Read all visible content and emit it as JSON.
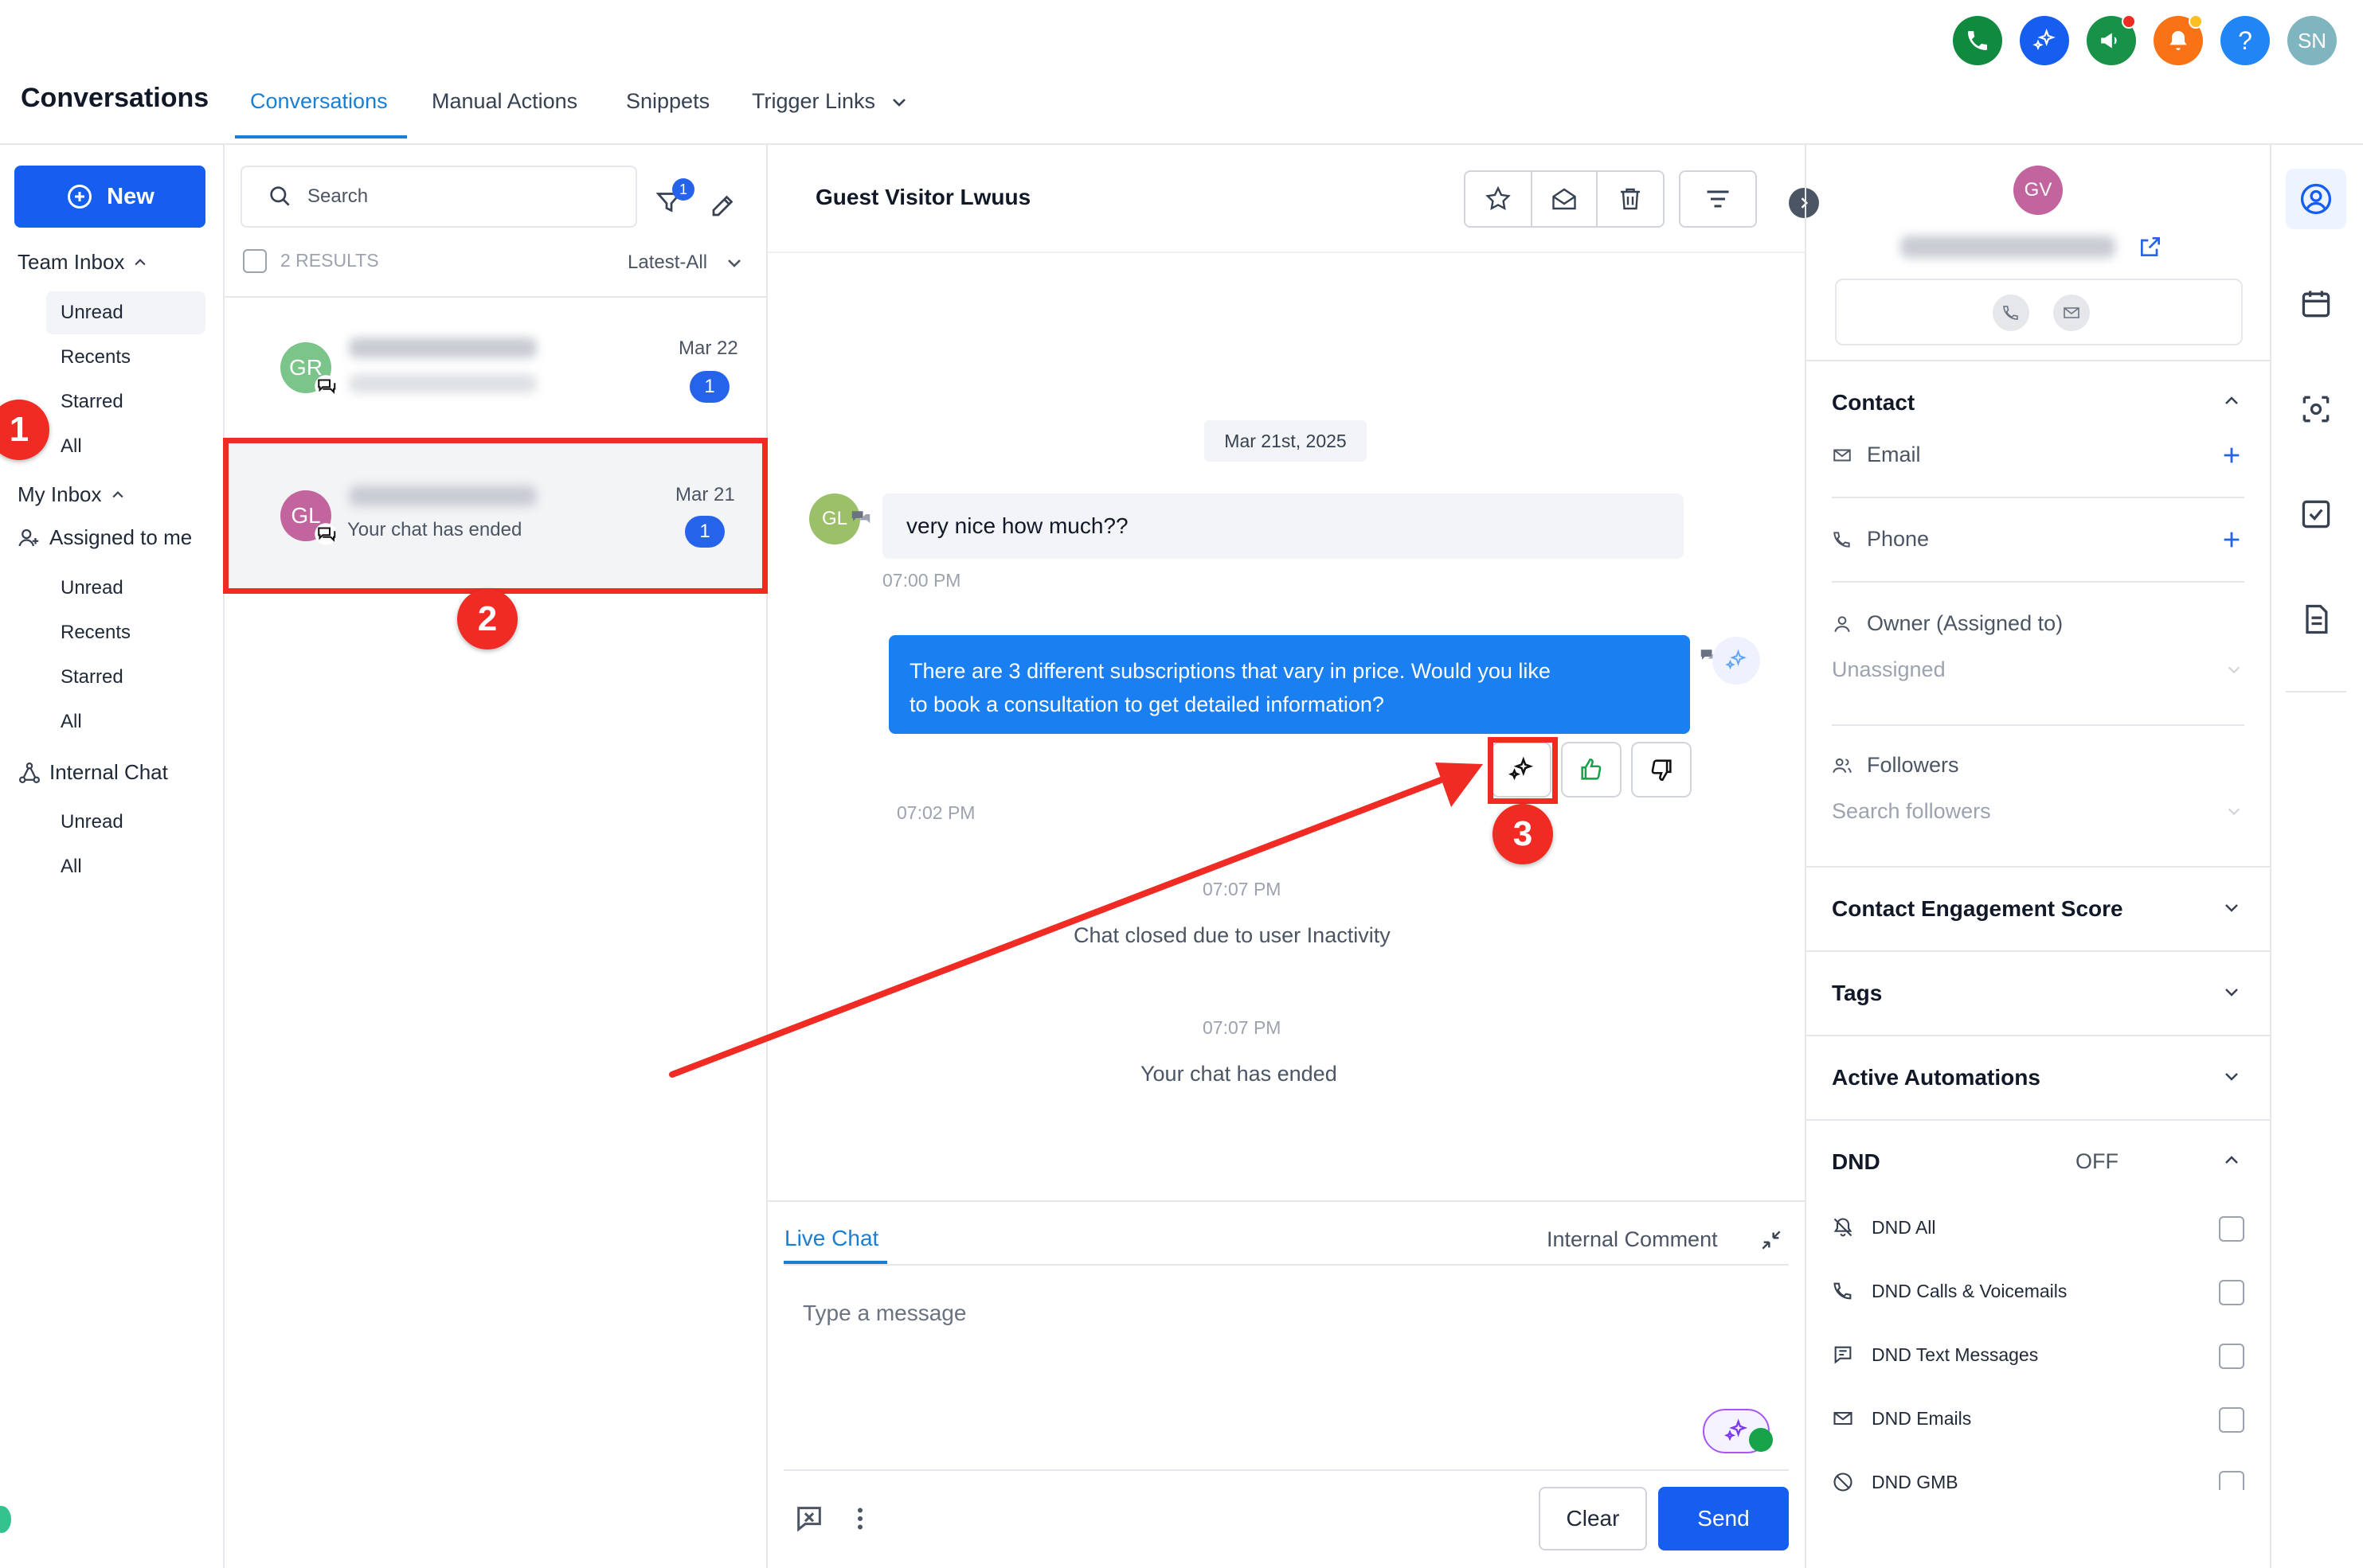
{
  "header": {
    "app_title": "Conversations",
    "tabs": [
      {
        "label": "Conversations",
        "active": true
      },
      {
        "label": "Manual Actions"
      },
      {
        "label": "Snippets"
      },
      {
        "label": "Trigger Links"
      }
    ],
    "user_initials": "SN",
    "help_glyph": "?",
    "icons": [
      "phone-icon",
      "ai-sparkle-icon",
      "megaphone-icon",
      "bell-icon",
      "help-icon"
    ]
  },
  "sidebar": {
    "new_button": "New",
    "team_inbox": {
      "label": "Team Inbox",
      "items": [
        "Unread",
        "Recents",
        "Starred",
        "All"
      ],
      "selected": "Unread"
    },
    "my_inbox": {
      "label": "My Inbox",
      "assigned": "Assigned to me",
      "items": [
        "Unread",
        "Recents",
        "Starred",
        "All"
      ]
    },
    "internal_chat": {
      "label": "Internal Chat",
      "items": [
        "Unread",
        "All"
      ]
    }
  },
  "list": {
    "search_placeholder": "Search",
    "filter_count": "1",
    "results_label": "2 RESULTS",
    "sort_label": "Latest-All",
    "conversations": [
      {
        "initials": "GR",
        "date": "Mar 22",
        "preview": "",
        "unread": "1",
        "avatar_color": "#7cc58a"
      },
      {
        "initials": "GL",
        "date": "Mar 21",
        "preview": "Your chat has ended",
        "unread": "1",
        "avatar_color": "#c2659e"
      }
    ]
  },
  "chat": {
    "contact_name": "Guest Visitor Lwuus",
    "date_divider": "Mar 21st, 2025",
    "incoming": {
      "initials": "GL",
      "text": "very nice how much??",
      "time": "07:00 PM"
    },
    "outgoing": {
      "line1": "There are 3 different subscriptions that vary in price. Would you like",
      "line2": "to book a consultation to get detailed information?",
      "time": "07:02 PM"
    },
    "system": [
      {
        "time": "07:07 PM",
        "text": "Chat closed due to user Inactivity"
      },
      {
        "time": "07:07 PM",
        "text": "Your chat has ended"
      }
    ]
  },
  "composer": {
    "tab_live": "Live Chat",
    "tab_internal": "Internal Comment",
    "placeholder": "Type a message",
    "clear": "Clear",
    "send": "Send"
  },
  "contact_panel": {
    "avatar_initials": "GV",
    "contact_section": "Contact",
    "email_label": "Email",
    "phone_label": "Phone",
    "owner_label": "Owner (Assigned to)",
    "owner_value": "Unassigned",
    "followers_label": "Followers",
    "followers_placeholder": "Search followers",
    "engagement": "Contact Engagement Score",
    "tags": "Tags",
    "automations": "Active Automations",
    "dnd": "DND",
    "dnd_state": "OFF",
    "dnd_items": [
      "DND All",
      "DND Calls & Voicemails",
      "DND Text Messages",
      "DND Emails",
      "DND GMB"
    ]
  },
  "annotations": [
    "1",
    "2",
    "3"
  ],
  "colors": {
    "accent": "#155eef",
    "tab_active": "#1a7fd3",
    "annotation": "#ef2b24",
    "bubble_out": "#1a7ff0"
  }
}
